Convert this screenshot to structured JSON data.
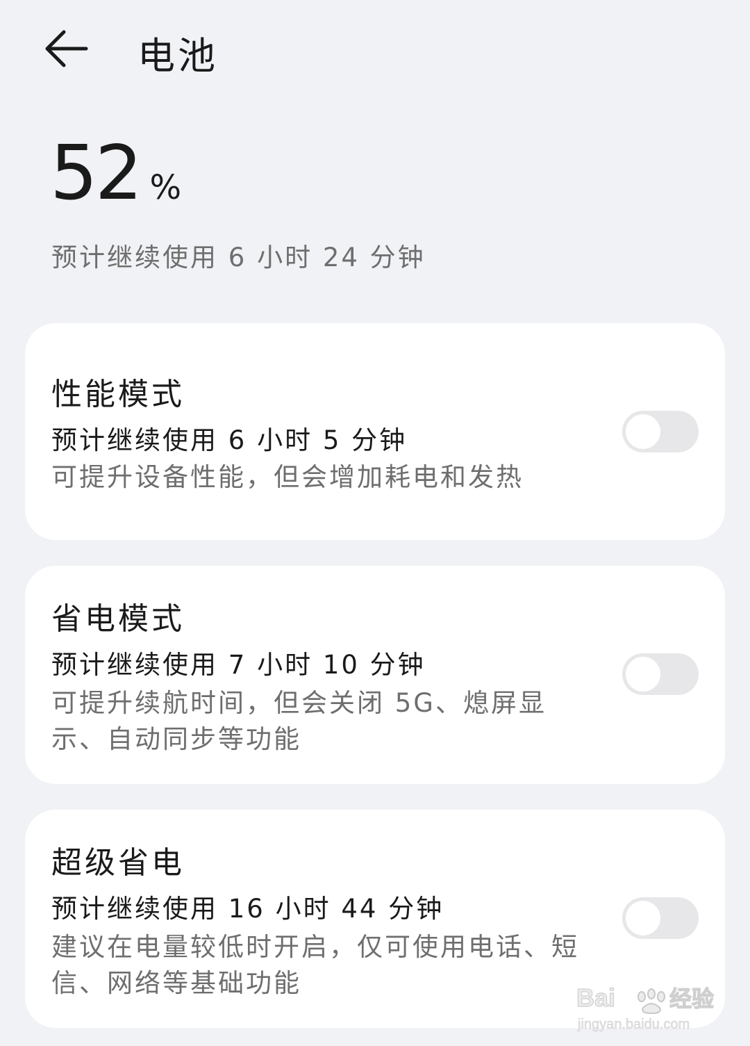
{
  "header": {
    "title": "电池",
    "back_icon": "arrow-left-icon"
  },
  "battery": {
    "level": "52",
    "unit": "%",
    "remaining": "预计继续使用 6 小时 24 分钟"
  },
  "modes": [
    {
      "title": "性能模式",
      "estimate": "预计继续使用 6 小时 5 分钟",
      "description": "可提升设备性能，但会增加耗电和发热",
      "enabled": false
    },
    {
      "title": "省电模式",
      "estimate": "预计继续使用 7 小时 10 分钟",
      "description": "可提升续航时间，但会关闭 5G、熄屏显示、自动同步等功能",
      "enabled": false
    },
    {
      "title": "超级省电",
      "estimate": "预计继续使用 16 小时 44 分钟",
      "description": "建议在电量较低时开启，仅可使用电话、短信、网络等基础功能",
      "enabled": false
    }
  ],
  "watermark": {
    "brand": "Bai du 经验",
    "url": "jingyan.baidu.com"
  },
  "colors": {
    "background": "#f1f2f5",
    "card": "#ffffff",
    "primary_text": "#1a1a1a",
    "secondary_text": "#6e6e6e",
    "toggle_off": "#e7e7e9"
  }
}
